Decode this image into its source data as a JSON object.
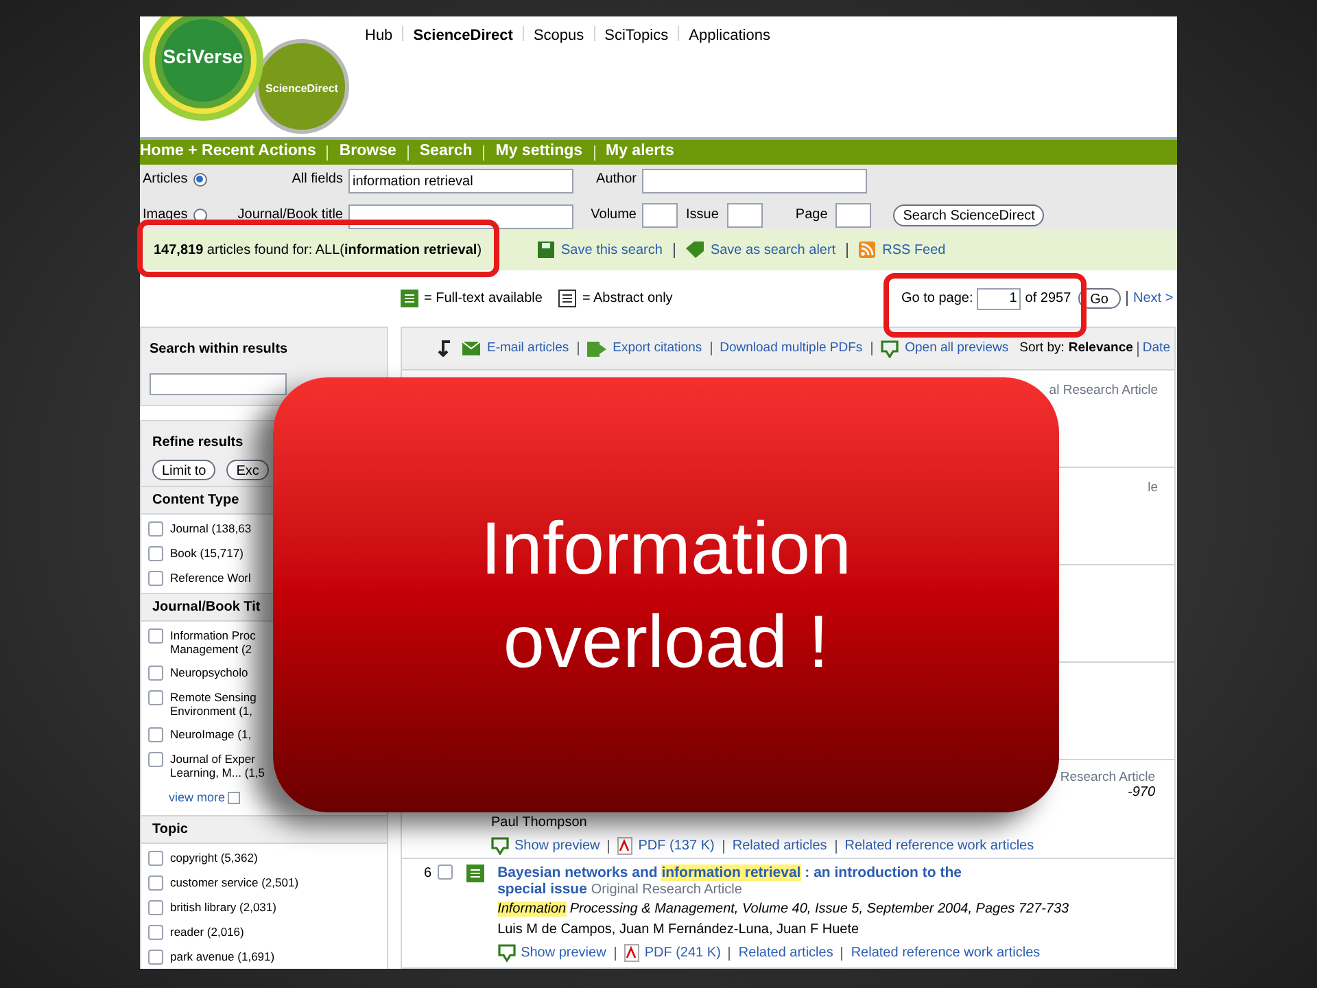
{
  "header": {
    "logo_primary": "SciVerse",
    "logo_secondary": "ScienceDirect",
    "nav_links": [
      {
        "label": "Hub",
        "selected": false
      },
      {
        "label": "ScienceDirect",
        "selected": true
      },
      {
        "label": "Scopus",
        "selected": false
      },
      {
        "label": "SciTopics",
        "selected": false
      },
      {
        "label": "Applications",
        "selected": false
      }
    ]
  },
  "main_nav": [
    "Home + Recent Actions",
    "Browse",
    "Search",
    "My settings",
    "My alerts"
  ],
  "search_form": {
    "sources": [
      {
        "label": "Articles",
        "selected": true
      },
      {
        "label": "Images",
        "selected": false
      }
    ],
    "fields": [
      {
        "label": "All fields",
        "value": "information retrieval"
      },
      {
        "label": "Author"
      },
      {
        "label": "Journal/Book title"
      },
      {
        "label": "Volume"
      },
      {
        "label": "Issue"
      },
      {
        "label": "Page"
      }
    ],
    "submit": "Search ScienceDirect"
  },
  "results_bar": {
    "summary": "**147,819** articles found for: ALL(**information retrieval**)",
    "actions": [
      {
        "kind": "save",
        "label": "Save this search"
      },
      {
        "kind": "alert",
        "label": "Save as search alert"
      },
      {
        "kind": "rss",
        "label": "RSS Feed"
      }
    ]
  },
  "legend": [
    {
      "kind": "fulltext",
      "label": "= Full-text available"
    },
    {
      "kind": "abstract",
      "label": "= Abstract only"
    }
  ],
  "pager": {
    "label": "Go to page:",
    "value": "1",
    "total": "of 2957",
    "button": "Go",
    "next": "Next >"
  },
  "sidebar": {
    "search_within": {
      "title": "Search within results"
    },
    "refine": {
      "title": "Refine results",
      "buttons": [
        "Limit to",
        "Exc"
      ]
    },
    "sections": [
      {
        "title": "Content Type",
        "items": [
          {
            "label": "Journal (138,63",
            "checked": false
          },
          {
            "label": "Book (15,717)",
            "checked": false
          },
          {
            "label": "Reference Worl",
            "checked": false
          }
        ]
      },
      {
        "title": "Journal/Book Tit",
        "items": [
          {
            "label": "Information Proc Management (2",
            "checked": false
          },
          {
            "label": "Neuropsycholo",
            "checked": false
          },
          {
            "label": "Remote Sensing Environment (1,",
            "checked": false
          },
          {
            "label": "NeuroImage (1,",
            "checked": false
          },
          {
            "label": "Journal of Exper Learning, M... (1,5",
            "checked": false
          }
        ],
        "more": "view more"
      },
      {
        "title": "Topic",
        "items": [
          {
            "label": "copyright (5,362)",
            "checked": false
          },
          {
            "label": "customer service (2,501)",
            "checked": false
          },
          {
            "label": "british library (2,031)",
            "checked": false
          },
          {
            "label": "reader (2,016)",
            "checked": false
          },
          {
            "label": "park avenue (1,691)",
            "checked": false
          }
        ]
      }
    ]
  },
  "toolbar": {
    "actions": [
      {
        "kind": "email",
        "label": "E-mail articles"
      },
      {
        "kind": "export",
        "label": "Export citations"
      },
      {
        "kind": "pdf",
        "label": "Download multiple PDFs"
      },
      {
        "kind": "preview",
        "label": "Open all previews"
      }
    ],
    "sort": {
      "label": "Sort by:",
      "options": [
        {
          "label": "Relevance",
          "selected": true
        },
        {
          "label": "Date",
          "selected": false
        }
      ]
    }
  },
  "results": [
    {
      "kind": "hidden",
      "type": "al Research Article"
    },
    {
      "kind": "hidden",
      "type": "le"
    },
    {
      "kind": "hidden"
    },
    {
      "kind": "hidden"
    },
    {
      "kind": "partial",
      "type": "Research Article",
      "journal": "-970",
      "authors": "Paul Thompson",
      "actions": [
        "Show preview",
        "PDF (137 K)",
        "Related articles",
        "Related reference work articles"
      ]
    },
    {
      "kind": "full",
      "number": "6",
      "checked": false,
      "title_parts": [
        {
          "text": "Bayesian networks and ",
          "highlight": false
        },
        {
          "text": "information retrieval",
          "highlight": true
        },
        {
          "text": " : an introduction to the special issue",
          "highlight": false
        }
      ],
      "type": "Original Research Article",
      "journal_parts": [
        {
          "text": "Information",
          "highlight": true
        },
        {
          "text": " Processing & Management, Volume 40, Issue 5, September 2004, Pages 727-733",
          "highlight": false
        }
      ],
      "authors": "Luis M de Campos, Juan M Fernández-Luna, Juan F Huete",
      "actions": [
        "Show preview",
        "PDF (241 K)",
        "Related articles",
        "Related reference work articles"
      ]
    }
  ],
  "callout": {
    "text": "Information overload !"
  }
}
